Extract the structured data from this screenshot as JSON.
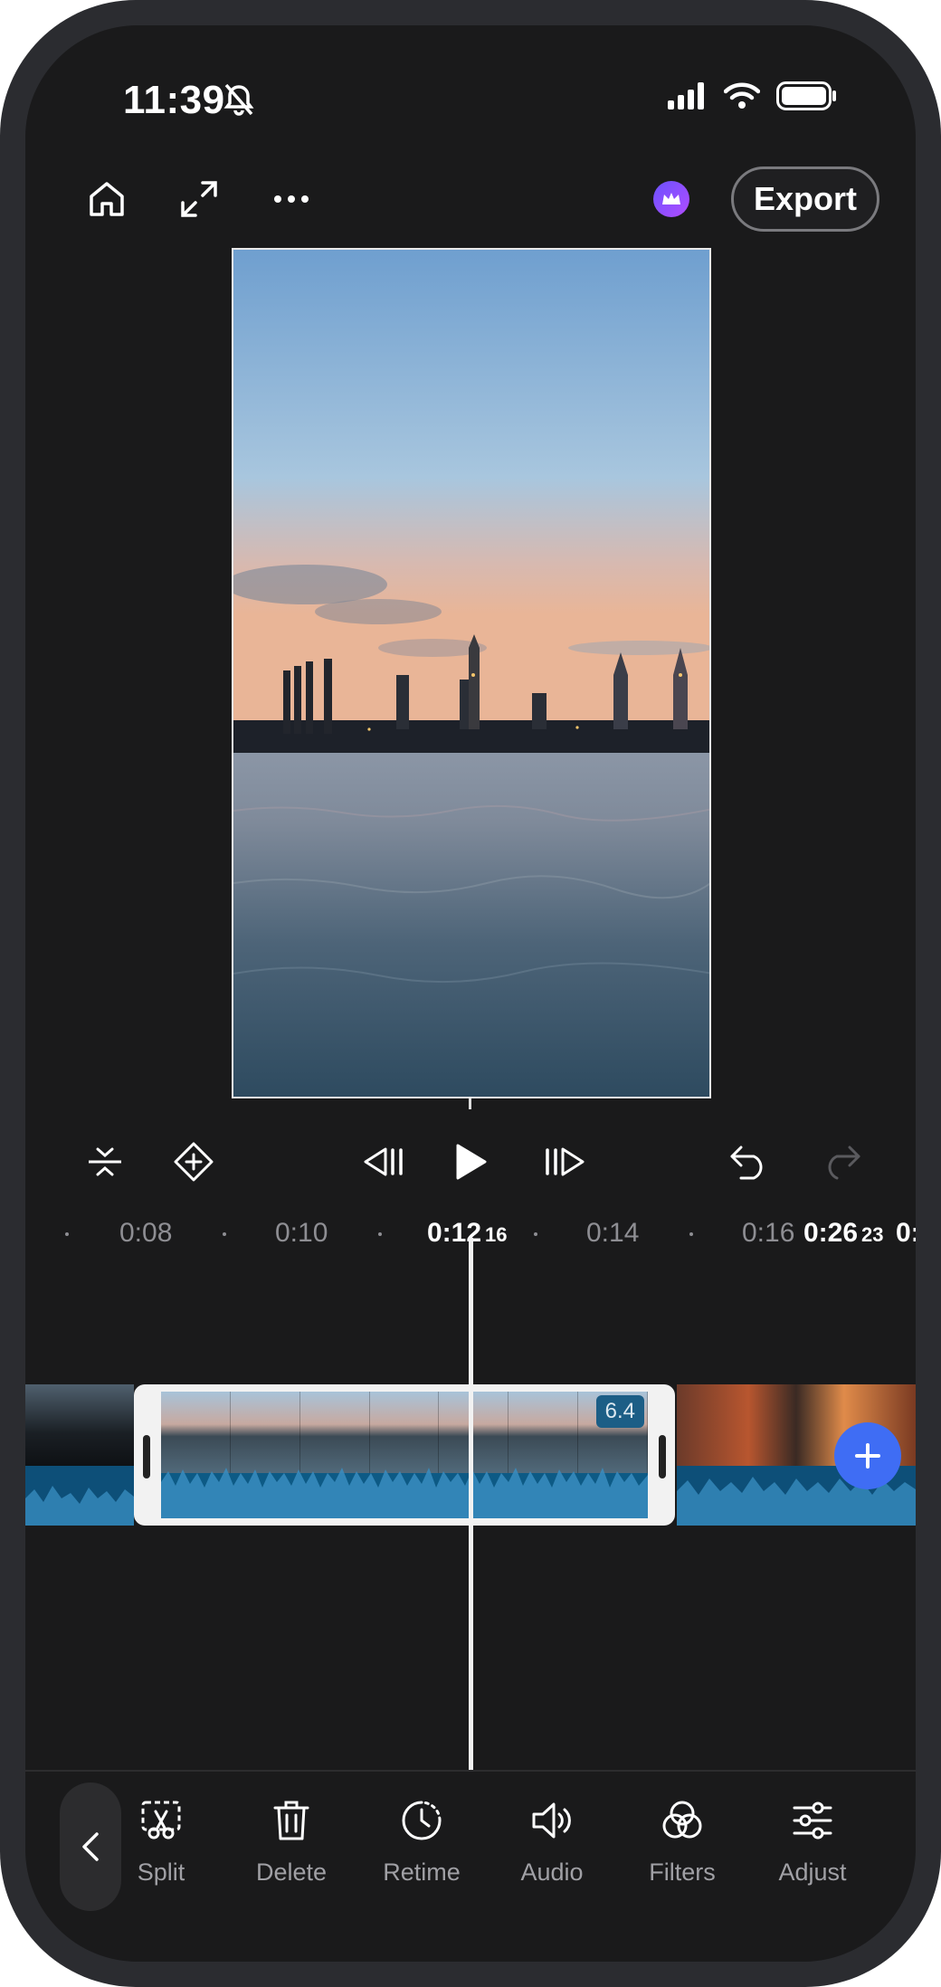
{
  "status_bar": {
    "time": "11:39"
  },
  "top_bar": {
    "export_label": "Export"
  },
  "ruler": {
    "labels": [
      "0:08",
      "0:10",
      "0:14",
      "0:16"
    ],
    "current_time": "0:12",
    "current_frame": "16",
    "total_time": "0:26",
    "total_frame": "23",
    "overflow_label": "0:"
  },
  "timeline": {
    "selected_clip_duration": "6.4",
    "accent_color": "#3f6df4"
  },
  "toolbar": {
    "items": [
      {
        "label": "Split"
      },
      {
        "label": "Delete"
      },
      {
        "label": "Retime"
      },
      {
        "label": "Audio"
      },
      {
        "label": "Filters"
      },
      {
        "label": "Adjust"
      }
    ]
  }
}
